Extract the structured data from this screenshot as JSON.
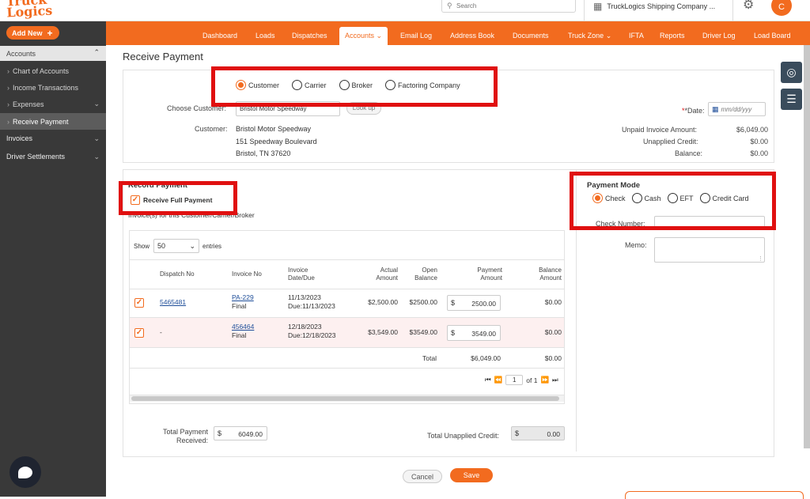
{
  "brand": {
    "logo_text_1": "Truck",
    "logo_text_2": "Logics",
    "accent": "#f26b1f"
  },
  "search": {
    "placeholder": "Search"
  },
  "header": {
    "company": "TruckLogics Shipping Company ...",
    "avatar_letter": "C"
  },
  "sidebar": {
    "add_new": "Add New",
    "section_accounts": "Accounts",
    "items": [
      "Chart of Accounts",
      "Income Transactions",
      "Expenses",
      "Receive Payment"
    ],
    "section_invoices": "Invoices",
    "section_driver": "Driver Settlements"
  },
  "nav": [
    "Dashboard",
    "Loads",
    "Dispatches",
    "Accounts",
    "Email Log",
    "Address Book",
    "Documents",
    "Truck Zone",
    "IFTA",
    "Reports",
    "Driver Log",
    "Load Board"
  ],
  "page": {
    "title": "Receive Payment"
  },
  "payer_types": [
    "Customer",
    "Carrier",
    "Broker",
    "Factoring Company"
  ],
  "customer_section": {
    "choose_label": "Choose Customer:",
    "choose_value": "Bristol Motor Speedway",
    "lookup": "Look up",
    "date_label": "*Date:",
    "date_placeholder": "mm/dd/yyy",
    "customer_label": "Customer:",
    "customer_name": "Bristol Motor Speedway",
    "address1": "151 Speedway Boulevard",
    "address2": "Bristol, TN 37620",
    "unpaid_label": "Unpaid Invoice Amount:",
    "unpaid_value": "$6,049.00",
    "unapplied_label": "Unapplied Credit:",
    "unapplied_value": "$0.00",
    "balance_label": "Balance:",
    "balance_value": "$0.00"
  },
  "record": {
    "title": "Record Payment",
    "full_payment": "Receive Full Payment",
    "invoices_caption": "Invoice(s) for this Customer/Carrier/Broker"
  },
  "table": {
    "show": "Show",
    "entries_value": "50",
    "entries": "entries",
    "headers": {
      "dispatch": "Dispatch No",
      "invoice": "Invoice No",
      "date1": "Invoice",
      "date2": "Date/Due",
      "actual1": "Actual",
      "actual2": "Amount",
      "open1": "Open",
      "open2": "Balance",
      "pay1": "Payment",
      "pay2": "Amount",
      "bal1": "Balance",
      "bal2": "Amount"
    },
    "rows": [
      {
        "dispatch": "5465481",
        "invoice": "PA-229",
        "status": "Final",
        "date": "11/13/2023",
        "due": "Due:11/13/2023",
        "actual": "$2,500.00",
        "open": "$2500.00",
        "payment": "2500.00",
        "balance": "$0.00"
      },
      {
        "dispatch": "-",
        "invoice": "456464",
        "status": "Final",
        "date": "12/18/2023",
        "due": "Due:12/18/2023",
        "actual": "$3,549.00",
        "open": "$3549.00",
        "payment": "3549.00",
        "balance": "$0.00"
      }
    ],
    "total_label": "Total",
    "total_payment": "$6,049.00",
    "total_balance": "$0.00",
    "page_current": "1",
    "page_of": "of 1"
  },
  "payment_mode": {
    "title": "Payment Mode",
    "options": [
      "Check",
      "Cash",
      "EFT",
      "Credit Card"
    ],
    "check_label": "Check Number:",
    "memo_label": "Memo:"
  },
  "totals": {
    "received_label_1": "Total Payment",
    "received_label_2": "Received:",
    "received_value": "6049.00",
    "unapplied_label": "Total Unapplied Credit:",
    "unapplied_value": "0.00",
    "currency": "$"
  },
  "actions": {
    "cancel": "Cancel",
    "save": "Save"
  }
}
